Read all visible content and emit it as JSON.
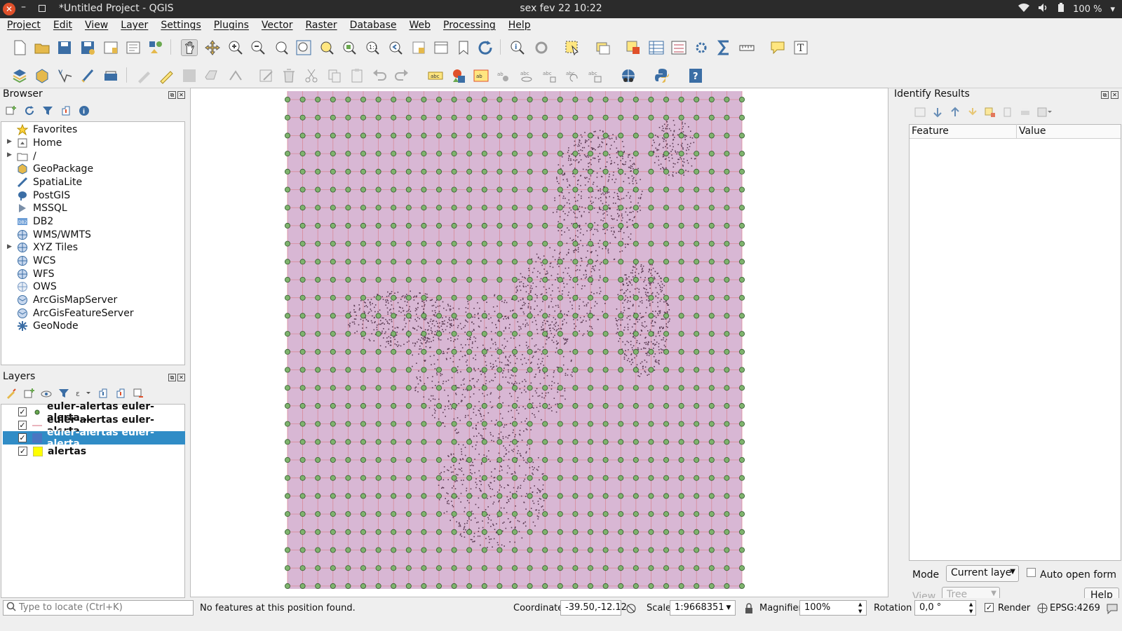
{
  "system": {
    "window_title": "*Untitled Project - QGIS",
    "clock": "sex fev 22  10:22",
    "battery": "100 %"
  },
  "menu": [
    "Project",
    "Edit",
    "View",
    "Layer",
    "Settings",
    "Plugins",
    "Vector",
    "Raster",
    "Database",
    "Web",
    "Processing",
    "Help"
  ],
  "browser": {
    "title": "Browser",
    "items": [
      "Favorites",
      "Home",
      "/",
      "GeoPackage",
      "SpatiaLite",
      "PostGIS",
      "MSSQL",
      "DB2",
      "WMS/WMTS",
      "XYZ Tiles",
      "WCS",
      "WFS",
      "OWS",
      "ArcGisMapServer",
      "ArcGisFeatureServer",
      "GeoNode"
    ]
  },
  "layers": {
    "title": "Layers",
    "items": [
      {
        "label": "euler-alertas euler-alerta...",
        "symbol": "point",
        "checked": true
      },
      {
        "label": "euler-alertas euler-alerta...",
        "symbol": "line",
        "checked": true
      },
      {
        "label": "euler-alertas euler-alerta...",
        "symbol": "polygon",
        "checked": true
      },
      {
        "label": "alertas",
        "symbol": "yellow",
        "checked": true
      }
    ]
  },
  "identify": {
    "title": "Identify Results",
    "col_feature": "Feature",
    "col_value": "Value",
    "mode_label": "Mode",
    "mode_value": "Current laye",
    "auto_open_label": "Auto open form",
    "view_label": "View",
    "view_value": "Tree",
    "help_label": "Help"
  },
  "status": {
    "locator_placeholder": "Type to locate (Ctrl+K)",
    "message": "No features at this position found.",
    "coordinate_label": "Coordinate",
    "coordinate_value": "-39.50,-12.12",
    "scale_label": "Scale",
    "scale_value": "1:9668351",
    "magnifier_label": "Magnifier",
    "magnifier_value": "100%",
    "rotation_label": "Rotation",
    "rotation_value": "0,0 °",
    "render_label": "Render",
    "crs": "EPSG:4269"
  },
  "colors": {
    "grid_fill": "#d8b7d4",
    "grid_line": "#d88a98",
    "point_fill": "#7fb36e",
    "point_stroke": "#2f5a2a",
    "alert_dots": "#5a3a52",
    "selected_row": "#308cc6"
  }
}
